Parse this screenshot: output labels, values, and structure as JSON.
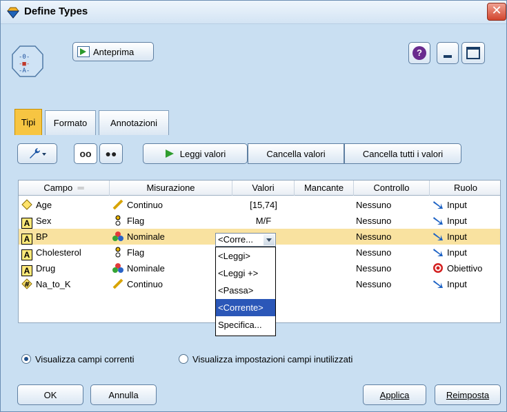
{
  "window": {
    "title": "Define Types",
    "close_symbol": "✕"
  },
  "header": {
    "preview_label": "Anteprima",
    "help_symbol": "?"
  },
  "tabs": [
    {
      "label": "Tipi",
      "active": true
    },
    {
      "label": "Formato",
      "active": false
    },
    {
      "label": "Annotazioni",
      "active": false
    }
  ],
  "toolbar": {
    "read_values": "Leggi valori",
    "clear_values": "Cancella valori",
    "clear_all_values": "Cancella tutti i valori"
  },
  "table": {
    "columns": [
      "Campo",
      "Misurazione",
      "Valori",
      "Mancante",
      "Controllo",
      "Ruolo"
    ],
    "rows": [
      {
        "field": "Age",
        "field_icon": "range-diamond-icon",
        "measure": "Continuo",
        "measure_icon": "ruler-icon",
        "values": "[15,74]",
        "missing": "",
        "check": "Nessuno",
        "role": "Input",
        "role_icon": "arrow-icon"
      },
      {
        "field": "Sex",
        "field_icon": "string-a-icon",
        "measure": "Flag",
        "measure_icon": "flag-icon",
        "values": "M/F",
        "missing": "",
        "check": "Nessuno",
        "role": "Input",
        "role_icon": "arrow-icon"
      },
      {
        "field": "BP",
        "field_icon": "string-a-icon",
        "measure": "Nominale",
        "measure_icon": "nominal-icon",
        "values": "<Corre...",
        "missing": "",
        "check": "Nessuno",
        "role": "Input",
        "role_icon": "arrow-icon",
        "selected": true
      },
      {
        "field": "Cholesterol",
        "field_icon": "string-a-icon",
        "measure": "Flag",
        "measure_icon": "flag-icon",
        "values": "",
        "missing": "",
        "check": "Nessuno",
        "role": "Input",
        "role_icon": "arrow-icon"
      },
      {
        "field": "Drug",
        "field_icon": "string-a-icon",
        "measure": "Nominale",
        "measure_icon": "nominal-icon",
        "values": "",
        "missing": "",
        "check": "Nessuno",
        "role": "Obiettivo",
        "role_icon": "target-icon"
      },
      {
        "field": "Na_to_K",
        "field_icon": "numeric-icon",
        "measure": "Continuo",
        "measure_icon": "ruler-icon",
        "values": "",
        "missing": "",
        "check": "Nessuno",
        "role": "Input",
        "role_icon": "arrow-icon"
      }
    ]
  },
  "dropdown": {
    "current": "<Corre...",
    "options": [
      "<Leggi>",
      "<Leggi +>",
      "<Passa>",
      "<Corrente>",
      "Specifica..."
    ],
    "highlighted": "<Corrente>"
  },
  "radios": [
    {
      "label": "Visualizza campi correnti",
      "checked": true
    },
    {
      "label": "Visualizza impostazioni campi inutilizzati",
      "checked": false
    }
  ],
  "buttons": {
    "ok": "OK",
    "cancel": "Annulla",
    "apply": "Applica",
    "reset": "Reimposta"
  },
  "colors": {
    "accent_tab": "#f7c542",
    "selected_row": "#f9e2a0",
    "highlight": "#2b57b8"
  }
}
